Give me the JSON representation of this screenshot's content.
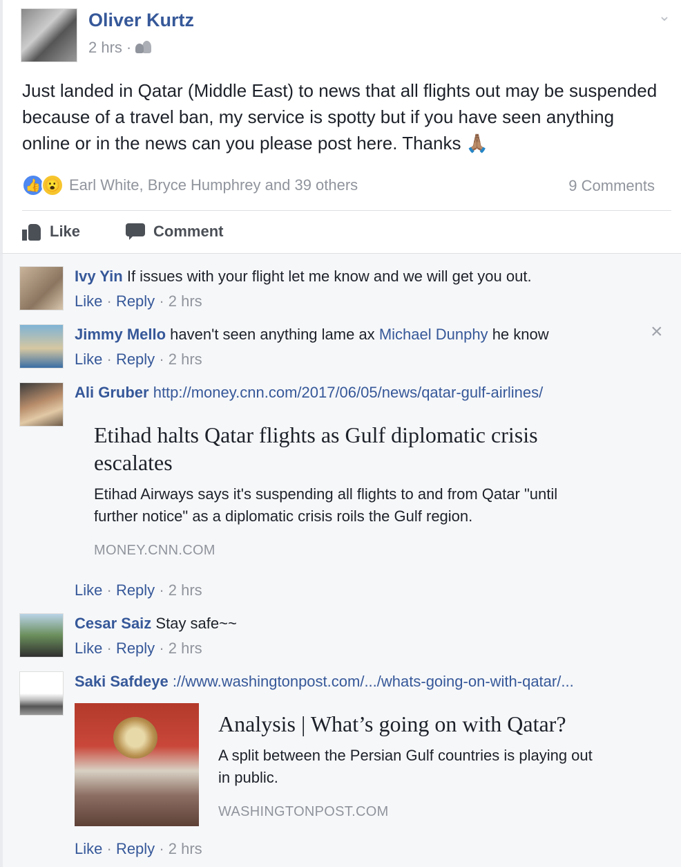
{
  "post": {
    "author": "Oliver Kurtz",
    "time": "2 hrs",
    "meta_separator": "·",
    "privacy_icon": "friends-icon",
    "text": "Just landed in Qatar (Middle East) to news that all flights out may be suspended because of a travel ban, my service is spotty but if you have seen anything online or in the news can you please post here. Thanks",
    "emoji": "🙏🏽",
    "reaction_icons": [
      "like-reaction",
      "wow-reaction"
    ],
    "reaction_names": "Earl White, Bryce Humphrey and 39 others",
    "comments_count": "9 Comments",
    "actions": {
      "like": "Like",
      "comment": "Comment"
    }
  },
  "comments": [
    {
      "name": "Ivy Yin",
      "text": "If issues with your flight let me know and we will get you out.",
      "like": "Like",
      "reply": "Reply",
      "time": "2 hrs"
    },
    {
      "name": "Jimmy Mello",
      "text_before": "haven't seen anything lame ax",
      "mention": "Michael Dunphy",
      "text_after": "he know",
      "like": "Like",
      "reply": "Reply",
      "time": "2 hrs"
    },
    {
      "name": "Ali Gruber",
      "link": "http://money.cnn.com/2017/06/05/news/qatar-gulf-airlines/",
      "card": {
        "title_line1": "Etihad halts Qatar flights as Gulf diplomatic crisis",
        "title_line2": "escalates",
        "desc_line1": "Etihad Airways says it's suspending all flights to and from Qatar \"until",
        "desc_line2": "further notice\" as a diplomatic crisis roils the Gulf region.",
        "domain": "MONEY.CNN.COM"
      },
      "like": "Like",
      "reply": "Reply",
      "time": "2 hrs"
    },
    {
      "name": "Cesar Saiz",
      "text": "Stay safe~~",
      "like": "Like",
      "reply": "Reply",
      "time": "2 hrs"
    },
    {
      "name": "Saki Safdeye",
      "link": "://www.washingtonpost.com/.../whats-going-on-with-qatar/...",
      "card": {
        "title": "Analysis | What’s going on with Qatar?",
        "desc_line1": "A split between the Persian Gulf countries is playing out",
        "desc_line2": "in public.",
        "domain": "WASHINGTONPOST.COM"
      },
      "like": "Like",
      "reply": "Reply",
      "time": "2 hrs"
    }
  ],
  "sep": "·"
}
